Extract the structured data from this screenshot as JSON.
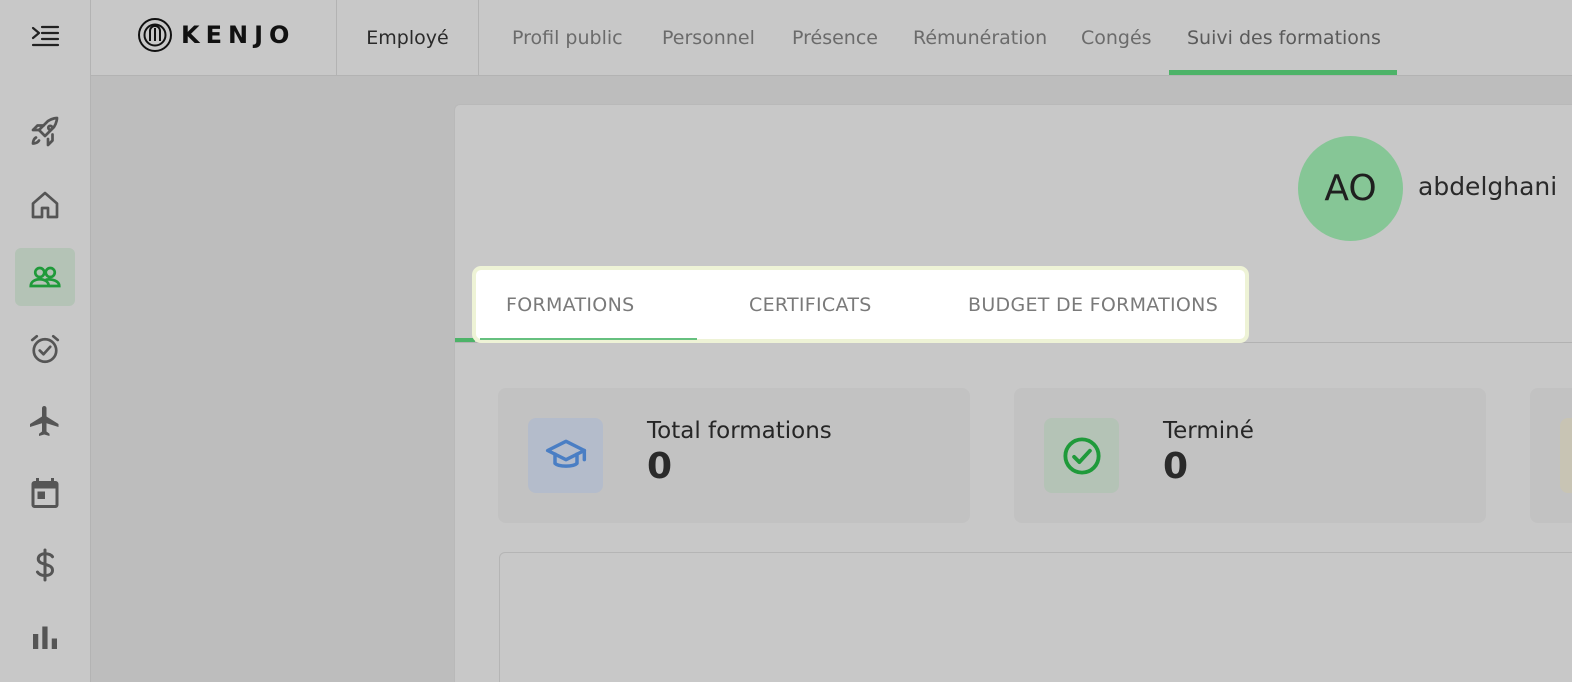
{
  "header": {
    "logo_text": "KENJO",
    "role": "Employé",
    "tabs": [
      {
        "label": "Profil public"
      },
      {
        "label": "Personnel"
      },
      {
        "label": "Présence"
      },
      {
        "label": "Rémunération"
      },
      {
        "label": "Congés"
      },
      {
        "label": "Suivi des formations"
      }
    ],
    "active_tab": "Suivi des formations"
  },
  "sidebar": {
    "items": [
      {
        "icon": "rocket-icon"
      },
      {
        "icon": "home-icon"
      },
      {
        "icon": "people-icon",
        "active": true
      },
      {
        "icon": "alarm-check-icon"
      },
      {
        "icon": "airplane-icon"
      },
      {
        "icon": "calendar-icon"
      },
      {
        "icon": "dollar-icon"
      },
      {
        "icon": "bar-chart-icon"
      }
    ]
  },
  "profile": {
    "initials": "AO",
    "name": "abdelghani"
  },
  "subtabs": [
    {
      "label": "FORMATIONS"
    },
    {
      "label": "CERTIFICATS"
    },
    {
      "label": "BUDGET DE FORMATIONS"
    }
  ],
  "stats": [
    {
      "label": "Total formations",
      "value": "0",
      "icon": "graduation-cap-icon"
    },
    {
      "label": "Terminé",
      "value": "0",
      "icon": "check-circle-icon"
    }
  ],
  "colors": {
    "accent_green": "#4db368",
    "avatar_bg": "#86c696",
    "cap_blue": "#4a7ec4",
    "check_green": "#1f9a3a"
  }
}
